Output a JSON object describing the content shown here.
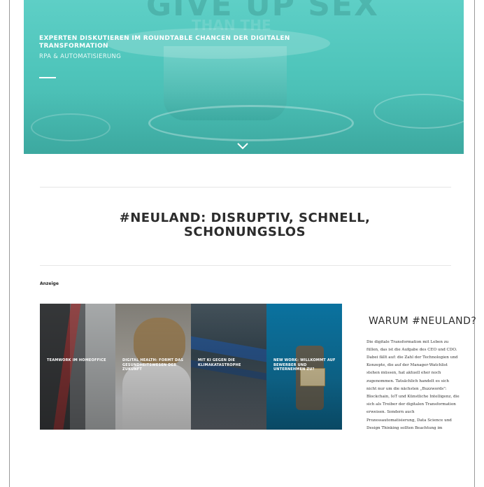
{
  "hero": {
    "headline": "EXPERTEN DISKUTIEREN IM ROUNDTABLE CHANCEN DER DIGITALEN TRANSFORMATION",
    "category": "RPA & AUTOMATISIERUNG",
    "background_text": "GIVE UP SEX",
    "background_text_2": "THAN THE",
    "accent": "#5ecfc6"
  },
  "section": {
    "title": "#NEULAND: DISRUPTIV, SCHNELL, SCHONUNGSLOS"
  },
  "ad": {
    "label": "Anzeige",
    "tiles": [
      {
        "label": "TEAMWORK IM HOMEOFFICE"
      },
      {
        "label": "DIGITAL HEALTH: FORMT DAS GESUNDHEITSWESEN DER ZUKUNFT"
      },
      {
        "label": "MIT KI GEGEN DIE KLIMAKATASTROPHE"
      },
      {
        "label": "NEW WORK: WILLKOMMT AUF BEWERBER UND UNTERNEHMEN ZU?"
      }
    ]
  },
  "sidebar": {
    "title": "WARUM #NEULAND?",
    "text": "Die digitale Transformation mit Leben zu füllen, das ist die Aufgabe des CEO und CDO. Dabei fällt auf: die Zahl der Technologien und Konzepte, die auf der Manager-Watchlist stehen müssen, hat aktuell eher noch zugenommen. Tatsächlich handelt es sich nicht nur um die nächsten „Buzzwords\": Blockchain, IoT und Künstliche Intelligenz, die sich als Treiber der digitalen Transformation erweisen. Sondern auch Prozessautomatisierung, Data Science und Design Thinking sollten Beachtung im"
  },
  "icons": {
    "scroll": "chevron-down-icon"
  }
}
